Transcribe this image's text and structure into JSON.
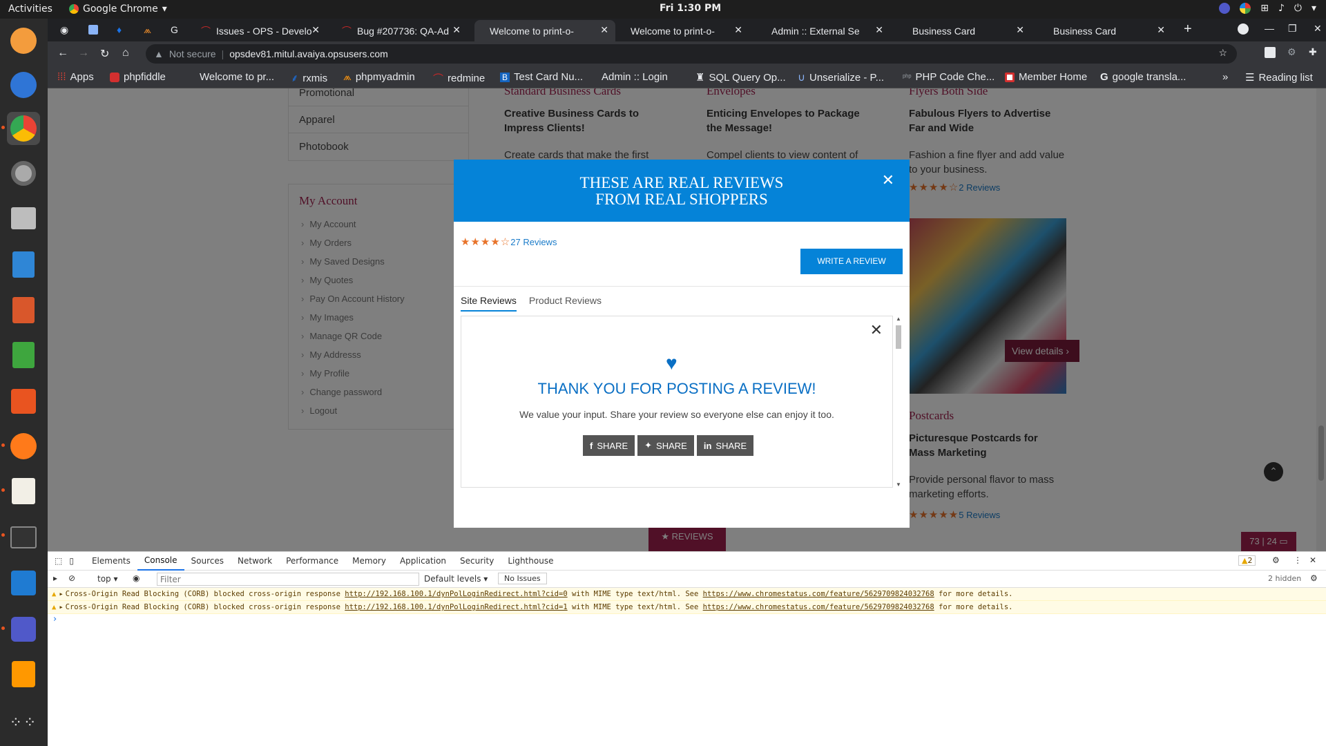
{
  "ubuntu_bar": {
    "activities": "Activities",
    "app": "Google Chrome",
    "clock": "Fri  1:30 PM"
  },
  "tabs": [
    {
      "title": "Issues - OPS - Develo"
    },
    {
      "title": "Bug #207736: QA-Ad"
    },
    {
      "title": "Welcome to print-o-"
    },
    {
      "title": "Welcome to print-o-"
    },
    {
      "title": "Admin :: External Se"
    },
    {
      "title": "Business Card"
    },
    {
      "title": "Business Card"
    }
  ],
  "address": {
    "security": "Not secure",
    "url": "opsdev81.mitul.avaiya.opsusers.com"
  },
  "bookmarks": [
    "Apps",
    "phpfiddle",
    "Welcome to pr...",
    "rxmis",
    "phpmyadmin",
    "redmine",
    "Test Card Nu...",
    "Admin :: Login",
    "SQL Query Op...",
    "Unserialize - P...",
    "PHP Code Che...",
    "Member Home",
    "google transla...",
    "»",
    "Reading list"
  ],
  "categories": [
    "Promotional",
    "Apparel",
    "Photobook"
  ],
  "my_account": {
    "title": "My Account",
    "items": [
      "My Account",
      "My Orders",
      "My Saved Designs",
      "My Quotes",
      "Pay On Account History",
      "My Images",
      "Manage QR Code",
      "My Addresss",
      "My Profile",
      "Change password",
      "Logout"
    ]
  },
  "products": [
    {
      "heading": "Standard Business Cards",
      "tagline": "Creative Business Cards to Impress Clients!",
      "desc": "Create cards that make the first"
    },
    {
      "heading": "Envelopes",
      "tagline": "Enticing Envelopes to Package the Message!",
      "desc": "Compel clients to view content of"
    },
    {
      "heading": "Flyers Both Side",
      "tagline": "Fabulous Flyers to Advertise Far and Wide",
      "desc": "Fashion a fine flyer and add value to your business.",
      "reviews": "2 Reviews",
      "rating": 4
    },
    {
      "heading": "Postcards",
      "tagline": "Picturesque Postcards for Mass Marketing",
      "desc": "Provide personal flavor to mass marketing efforts.",
      "reviews": "5 Reviews",
      "rating": 5,
      "view_details": "View details"
    }
  ],
  "reviews_tab": "★ REVIEWS",
  "counter": "73 | 24",
  "modal": {
    "title_line1": "THESE ARE REAL REVIEWS",
    "title_line2": "FROM REAL SHOPPERS",
    "rating": 4,
    "review_count": "27 Reviews",
    "write_button": "WRITE A REVIEW",
    "tabs": [
      "Site Reviews",
      "Product Reviews"
    ],
    "thank_title": "THANK YOU FOR POSTING A REVIEW!",
    "thank_sub": "We value your input. Share your review so everyone else can enjoy it too.",
    "share_labels": [
      "SHARE",
      "SHARE",
      "SHARE"
    ]
  },
  "devtools": {
    "tabs": [
      "Elements",
      "Console",
      "Sources",
      "Network",
      "Performance",
      "Memory",
      "Application",
      "Security",
      "Lighthouse"
    ],
    "active_tab": "Console",
    "warnings_badge": "2",
    "context": "top",
    "filter_placeholder": "Filter",
    "levels": "Default levels",
    "issues": "No Issues",
    "hidden": "2 hidden",
    "messages": [
      {
        "prefix": "Cross-Origin Read Blocking (CORB) blocked cross-origin response",
        "url": "http://192.168.100.1/dynPolLoginRedirect.html?cid=0",
        "mid": "with MIME type text/html. See",
        "link": "https://www.chromestatus.com/feature/5629709824032768",
        "suffix": "for more details."
      },
      {
        "prefix": "Cross-Origin Read Blocking (CORB) blocked cross-origin response",
        "url": "http://192.168.100.1/dynPolLoginRedirect.html?cid=1",
        "mid": "with MIME type text/html. See",
        "link": "https://www.chromestatus.com/feature/5629709824032768",
        "suffix": "for more details."
      }
    ],
    "prompt": "›"
  }
}
